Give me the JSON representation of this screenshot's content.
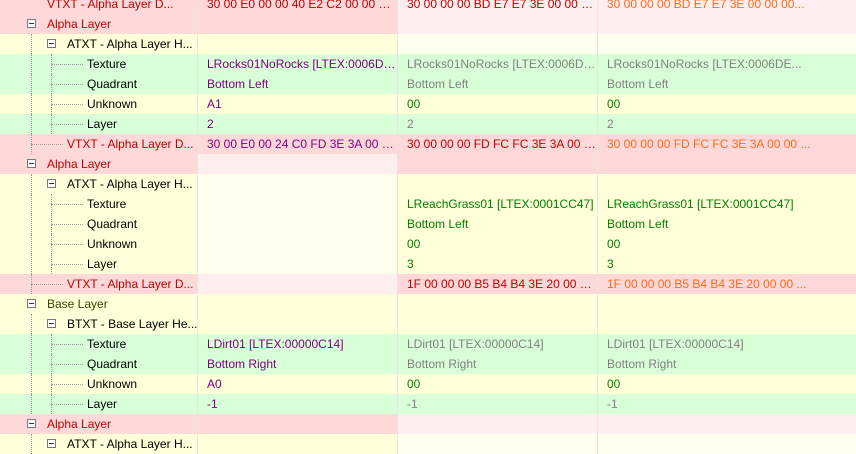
{
  "rows": [
    {
      "level": 0,
      "toggle": false,
      "bg": "bg-pink",
      "label": "VTXT - Alpha Layer D...",
      "lc": "t-red",
      "v": [
        "30 00 E0 00 00 40 E2 C2 00 00 40 ...",
        "30 00 00 00 BD E7 E7 3E 00 00 00...",
        "30 00 00 00 BD E7 E7 3E 00 00 00..."
      ],
      "vc": [
        "t-red",
        "t-red",
        "t-orange"
      ],
      "hl": [
        false,
        true,
        true
      ]
    },
    {
      "level": 0,
      "toggle": true,
      "bg": "bg-pink",
      "label": "Alpha Layer",
      "lc": "t-red",
      "v": [
        "",
        "",
        ""
      ],
      "vc": [
        "t-red",
        "t-red",
        "t-red"
      ],
      "hl": [
        false,
        true,
        true
      ]
    },
    {
      "level": 1,
      "toggle": true,
      "bg": "bg-yellow",
      "label": "ATXT - Alpha Layer H...",
      "lc": "t-black",
      "v": [
        "",
        "",
        ""
      ],
      "vc": [
        "t-black",
        "t-black",
        "t-black"
      ],
      "hl": [
        false,
        true,
        true
      ]
    },
    {
      "level": 2,
      "toggle": false,
      "bg": "bg-green",
      "label": "Texture",
      "lc": "t-black",
      "v": [
        "LRocks01NoRocks [LTEX:0006DE...",
        "LRocks01NoRocks [LTEX:0006DE...",
        "LRocks01NoRocks [LTEX:0006DE..."
      ],
      "vc": [
        "t-purple",
        "t-gray",
        "t-gray"
      ],
      "hl": [
        false,
        false,
        false
      ]
    },
    {
      "level": 2,
      "toggle": false,
      "bg": "bg-green",
      "label": "Quadrant",
      "lc": "t-black",
      "v": [
        "Bottom Left",
        "Bottom Left",
        "Bottom Left"
      ],
      "vc": [
        "t-purple",
        "t-gray",
        "t-gray"
      ],
      "hl": [
        false,
        false,
        false
      ]
    },
    {
      "level": 2,
      "toggle": false,
      "bg": "bg-yellow",
      "label": "Unknown",
      "lc": "t-black",
      "v": [
        "A1",
        "00",
        "00"
      ],
      "vc": [
        "t-purple",
        "t-green",
        "t-green"
      ],
      "hl": [
        false,
        false,
        false
      ]
    },
    {
      "level": 2,
      "toggle": false,
      "bg": "bg-green",
      "label": "Layer",
      "lc": "t-black",
      "v": [
        "2",
        "2",
        "2"
      ],
      "vc": [
        "t-purple",
        "t-gray",
        "t-gray"
      ],
      "hl": [
        false,
        false,
        false
      ]
    },
    {
      "level": 1,
      "toggle": false,
      "bg": "bg-pink",
      "label": "VTXT - Alpha Layer D...",
      "lc": "t-red",
      "v": [
        "30 00 E0 00 24 C0 FD 3E 3A 00 75 ...",
        "30 00 00 00 FD FC FC 3E 3A 00 00 ...",
        "30 00 00 00 FD FC FC 3E 3A 00 00 ..."
      ],
      "vc": [
        "t-purple",
        "t-red",
        "t-orange"
      ],
      "hl": [
        false,
        false,
        false
      ]
    },
    {
      "level": 0,
      "toggle": true,
      "bg": "bg-pink",
      "label": "Alpha Layer",
      "lc": "t-red",
      "v": [
        "",
        "",
        ""
      ],
      "vc": [
        "t-red",
        "t-red",
        "t-red"
      ],
      "hl": [
        true,
        false,
        false
      ]
    },
    {
      "level": 1,
      "toggle": true,
      "bg": "bg-yellow",
      "label": "ATXT - Alpha Layer H...",
      "lc": "t-black",
      "v": [
        "",
        "",
        ""
      ],
      "vc": [
        "t-black",
        "t-black",
        "t-black"
      ],
      "hl": [
        true,
        false,
        false
      ]
    },
    {
      "level": 2,
      "toggle": false,
      "bg": "bg-yellow",
      "label": "Texture",
      "lc": "t-black",
      "v": [
        "",
        "LReachGrass01 [LTEX:0001CC47]",
        "LReachGrass01 [LTEX:0001CC47]"
      ],
      "vc": [
        "t-black",
        "t-green",
        "t-green"
      ],
      "hl": [
        true,
        false,
        false
      ]
    },
    {
      "level": 2,
      "toggle": false,
      "bg": "bg-yellow",
      "label": "Quadrant",
      "lc": "t-black",
      "v": [
        "",
        "Bottom Left",
        "Bottom Left"
      ],
      "vc": [
        "t-black",
        "t-green",
        "t-green"
      ],
      "hl": [
        true,
        false,
        false
      ]
    },
    {
      "level": 2,
      "toggle": false,
      "bg": "bg-yellow",
      "label": "Unknown",
      "lc": "t-black",
      "v": [
        "",
        "00",
        "00"
      ],
      "vc": [
        "t-black",
        "t-green",
        "t-green"
      ],
      "hl": [
        true,
        false,
        false
      ]
    },
    {
      "level": 2,
      "toggle": false,
      "bg": "bg-yellow",
      "label": "Layer",
      "lc": "t-black",
      "v": [
        "",
        "3",
        "3"
      ],
      "vc": [
        "t-black",
        "t-green",
        "t-green"
      ],
      "hl": [
        true,
        false,
        false
      ]
    },
    {
      "level": 1,
      "toggle": false,
      "bg": "bg-pink",
      "label": "VTXT - Alpha Layer D...",
      "lc": "t-red",
      "v": [
        "",
        "1F 00 00 00 B5 B4 B4 3E 20 00 00 ...",
        "1F 00 00 00 B5 B4 B4 3E 20 00 00 ..."
      ],
      "vc": [
        "t-red",
        "t-red",
        "t-orange"
      ],
      "hl": [
        true,
        false,
        false
      ]
    },
    {
      "level": 0,
      "toggle": true,
      "bg": "bg-yellow",
      "label": "Base Layer",
      "lc": "t-olive",
      "v": [
        "",
        "",
        ""
      ],
      "vc": [
        "t-black",
        "t-black",
        "t-black"
      ],
      "hl": [
        false,
        false,
        false
      ]
    },
    {
      "level": 1,
      "toggle": true,
      "bg": "bg-yellow",
      "label": "BTXT - Base Layer He...",
      "lc": "t-black",
      "v": [
        "",
        "",
        ""
      ],
      "vc": [
        "t-black",
        "t-black",
        "t-black"
      ],
      "hl": [
        false,
        false,
        false
      ]
    },
    {
      "level": 2,
      "toggle": false,
      "bg": "bg-green",
      "label": "Texture",
      "lc": "t-black",
      "v": [
        "LDirt01 [LTEX:00000C14]",
        "LDirt01 [LTEX:00000C14]",
        "LDirt01 [LTEX:00000C14]"
      ],
      "vc": [
        "t-purple",
        "t-gray",
        "t-gray"
      ],
      "hl": [
        false,
        false,
        false
      ]
    },
    {
      "level": 2,
      "toggle": false,
      "bg": "bg-green",
      "label": "Quadrant",
      "lc": "t-black",
      "v": [
        "Bottom Right",
        "Bottom Right",
        "Bottom Right"
      ],
      "vc": [
        "t-purple",
        "t-gray",
        "t-gray"
      ],
      "hl": [
        false,
        false,
        false
      ]
    },
    {
      "level": 2,
      "toggle": false,
      "bg": "bg-yellow",
      "label": "Unknown",
      "lc": "t-black",
      "v": [
        "A0",
        "00",
        "00"
      ],
      "vc": [
        "t-purple",
        "t-green",
        "t-green"
      ],
      "hl": [
        false,
        false,
        false
      ]
    },
    {
      "level": 2,
      "toggle": false,
      "bg": "bg-green",
      "label": "Layer",
      "lc": "t-black",
      "v": [
        "-1",
        "-1",
        "-1"
      ],
      "vc": [
        "t-purple",
        "t-gray",
        "t-gray"
      ],
      "hl": [
        false,
        false,
        false
      ]
    },
    {
      "level": 0,
      "toggle": true,
      "bg": "bg-pink",
      "label": "Alpha Layer",
      "lc": "t-red",
      "v": [
        "",
        "",
        ""
      ],
      "vc": [
        "t-red",
        "t-red",
        "t-red"
      ],
      "hl": [
        false,
        true,
        true
      ]
    },
    {
      "level": 1,
      "toggle": true,
      "bg": "bg-yellow",
      "label": "ATXT - Alpha Layer H...",
      "lc": "t-black",
      "v": [
        "",
        "",
        ""
      ],
      "vc": [
        "t-black",
        "t-black",
        "t-black"
      ],
      "hl": [
        false,
        true,
        true
      ]
    }
  ]
}
